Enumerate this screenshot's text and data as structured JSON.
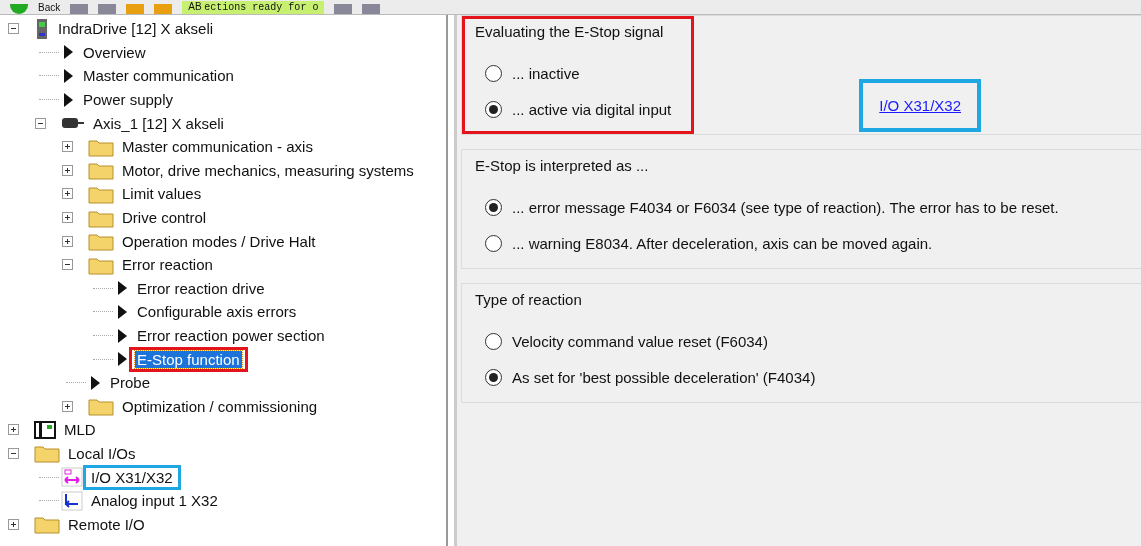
{
  "toolbar": {
    "back_label": "Back",
    "status_code": "AB",
    "status_text": "ections ready for o"
  },
  "tree": [
    {
      "kind": "device",
      "label": "IndraDrive [12] X akseli",
      "expanded": true,
      "selected": false,
      "children": [
        {
          "kind": "item",
          "label": "Overview",
          "selected": false
        },
        {
          "kind": "item",
          "label": "Master communication",
          "selected": false
        },
        {
          "kind": "item",
          "label": "Power supply",
          "selected": false
        },
        {
          "kind": "axis",
          "label": "Axis_1 [12] X akseli",
          "expanded": true,
          "selected": false,
          "children": [
            {
              "kind": "folder",
              "label": "Master communication - axis",
              "expanded": false,
              "selected": false
            },
            {
              "kind": "folder",
              "label": "Motor, drive mechanics, measuring systems",
              "expanded": false,
              "selected": false
            },
            {
              "kind": "folder",
              "label": "Limit values",
              "expanded": false,
              "selected": false
            },
            {
              "kind": "folder",
              "label": "Drive control",
              "expanded": false,
              "selected": false
            },
            {
              "kind": "folder",
              "label": "Operation modes / Drive Halt",
              "expanded": false,
              "selected": false
            },
            {
              "kind": "folder",
              "label": "Error reaction",
              "expanded": true,
              "selected": false,
              "children": [
                {
                  "kind": "item",
                  "label": "Error reaction drive",
                  "selected": false
                },
                {
                  "kind": "item",
                  "label": "Configurable axis errors",
                  "selected": false
                },
                {
                  "kind": "item",
                  "label": "Error reaction power section",
                  "selected": false
                },
                {
                  "kind": "item",
                  "label": "E-Stop function",
                  "selected": true,
                  "color": "#e3141c"
                }
              ]
            },
            {
              "kind": "item",
              "label": "Probe",
              "selected": false
            },
            {
              "kind": "folder",
              "label": "Optimization / commissioning",
              "expanded": false,
              "selected": false
            }
          ]
        }
      ]
    },
    {
      "kind": "mld",
      "label": "MLD",
      "expanded": false,
      "selected": false
    },
    {
      "kind": "folder",
      "label": "Local I/Os",
      "expanded": true,
      "selected": false,
      "children": [
        {
          "kind": "io",
          "label": "I/O X31/X32",
          "selected": false,
          "color": "#1ea7e0"
        },
        {
          "kind": "analog",
          "label": "Analog input 1 X32",
          "selected": false
        }
      ]
    },
    {
      "kind": "folder",
      "label": "Remote I/O",
      "expanded": false,
      "selected": false
    }
  ],
  "groups": [
    {
      "title": "Evaluating the E-Stop signal",
      "color": "#e3141c",
      "options": [
        {
          "label": "... inactive",
          "selected": false
        },
        {
          "label": "... active via digital input",
          "selected": true
        }
      ],
      "link": {
        "label": "I/O X31/X32",
        "color": "#1ea7e0"
      }
    },
    {
      "title": "E-Stop is interpreted as ...",
      "options": [
        {
          "label": "... error message F4034 or F6034 (see type of reaction). The error has to be reset.",
          "selected": true
        },
        {
          "label": "... warning E8034. After deceleration, axis can be moved again.",
          "selected": false
        }
      ]
    },
    {
      "title": "Type of reaction",
      "options": [
        {
          "label": "Velocity command value reset (F6034)",
          "selected": false
        },
        {
          "label": "As set for 'best possible deceleration' (F4034)",
          "selected": true
        }
      ]
    }
  ]
}
